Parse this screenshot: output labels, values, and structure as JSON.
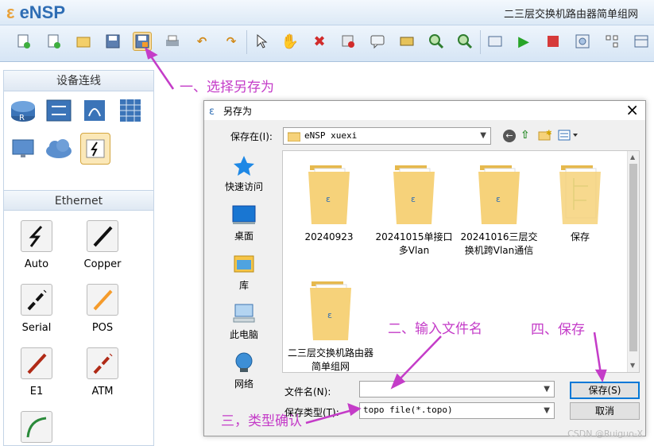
{
  "app": {
    "name": "eNSP",
    "window_title": "二三层交换机路由器简单组网"
  },
  "toolbar": {
    "icons": [
      "new-topology-icon",
      "new-wizard-icon",
      "open-icon",
      "save-icon",
      "save-as-icon",
      "print-icon",
      "undo-icon",
      "redo-icon",
      "select-icon",
      "pan-hand-icon",
      "delete-icon",
      "delete-link-icon",
      "text-note-icon",
      "rectangle-icon",
      "zoom-in-icon",
      "zoom-out-icon",
      "reset-zoom-icon",
      "start-device-icon",
      "stop-device-icon",
      "capture-icon",
      "topology-icon",
      "grid-icon"
    ]
  },
  "left_panel": {
    "devices_title": "设备连线",
    "ethernet_title": "Ethernet",
    "cables": [
      {
        "label": "Auto",
        "color": "#111111",
        "type": "bolt"
      },
      {
        "label": "Copper",
        "color": "#111111",
        "type": "line"
      },
      {
        "label": "Serial",
        "color": "#111111",
        "type": "dashed"
      },
      {
        "label": "POS",
        "color": "#f59b2b",
        "type": "line"
      },
      {
        "label": "E1",
        "color": "#b02a16",
        "type": "line"
      },
      {
        "label": "ATM",
        "color": "#b02a16",
        "type": "dashed"
      },
      {
        "label": "",
        "color": "#2a8a3a",
        "type": "curve"
      }
    ]
  },
  "dialog": {
    "title": "另存为",
    "close_label": "×",
    "save_in_label": "保存在(I):",
    "save_in_value": "eNSP xuexi",
    "sidebar": [
      {
        "label": "快速访问",
        "icon": "star-icon"
      },
      {
        "label": "桌面",
        "icon": "desktop-icon"
      },
      {
        "label": "库",
        "icon": "library-icon"
      },
      {
        "label": "此电脑",
        "icon": "computer-icon"
      },
      {
        "label": "网络",
        "icon": "network-icon"
      }
    ],
    "files": [
      "20240923",
      "20241015单接口多Vlan",
      "20241016三层交换机跨Vlan通信",
      "保存",
      "二三层交换机路由器简单组网"
    ],
    "filename_label": "文件名(N):",
    "filename_value": "",
    "filetype_label": "保存类型(T):",
    "filetype_value": "topo file(*.topo)",
    "save_button": "保存(S)",
    "cancel_button": "取消"
  },
  "annotations": {
    "step1": "一、选择另存为",
    "step2": "二、输入文件名",
    "step3": "三，类型确认",
    "step4": "四、保存"
  },
  "watermark": "CSDN @Ruiguo-X",
  "colors": {
    "annotation": "#c43cc8",
    "accent": "#2e6db4",
    "folder": "#f6d27a"
  }
}
